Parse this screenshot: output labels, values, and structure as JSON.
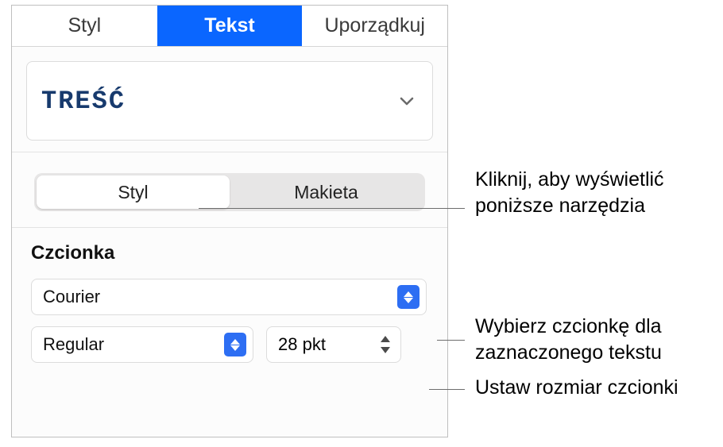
{
  "tabs": {
    "style": "Styl",
    "text": "Tekst",
    "arrange": "Uporządkuj"
  },
  "paragraph_style": {
    "name": "TREŚĆ"
  },
  "subtabs": {
    "style": "Styl",
    "layout": "Makieta"
  },
  "font": {
    "section_title": "Czcionka",
    "family": "Courier",
    "weight": "Regular",
    "size": "28 pkt"
  },
  "callouts": {
    "subtabs": "Kliknij, aby wyświetlić poniższe narzędzia",
    "family": "Wybierz czcionkę dla zaznaczonego tekstu",
    "size": "Ustaw rozmiar czcionki"
  }
}
